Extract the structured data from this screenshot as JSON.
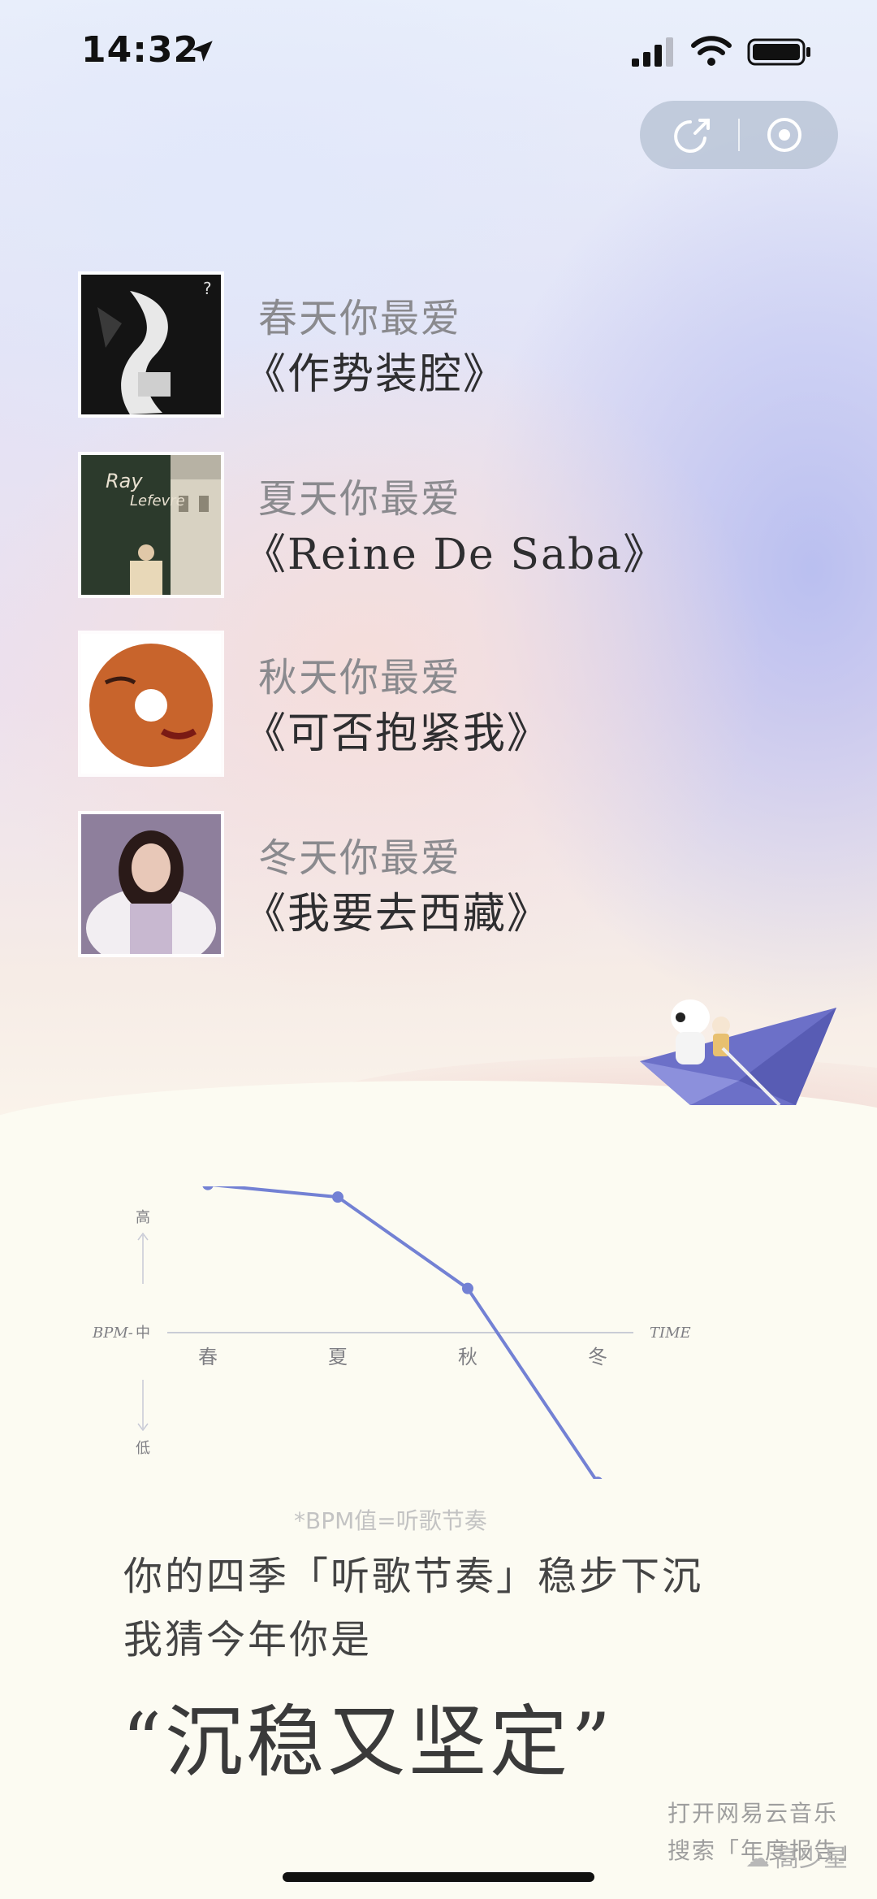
{
  "status_bar": {
    "time": "14:32"
  },
  "capsule": {
    "share_icon": "share-icon",
    "close_icon": "mini-program-close-icon"
  },
  "songs": [
    {
      "season": "春天你最爱",
      "title": "《作势装腔》"
    },
    {
      "season": "夏天你最爱",
      "title": "《Reine De Saba》"
    },
    {
      "season": "秋天你最爱",
      "title": "《可否抱紧我》"
    },
    {
      "season": "冬天你最爱",
      "title": "《我要去西藏》"
    }
  ],
  "chart_data": {
    "type": "line",
    "categories": [
      "春",
      "夏",
      "秋",
      "冬"
    ],
    "values": [
      0.94,
      0.86,
      0.28,
      -0.95
    ],
    "ylabel_axis": "BPM-",
    "y_levels": [
      "高",
      "中",
      "低"
    ],
    "xlabel": "TIME",
    "ylim": [
      -1,
      1
    ],
    "grid": false,
    "colors": {
      "line": "#7381d4",
      "axis": "#b9bccd"
    }
  },
  "footnote": "*BPM值=听歌节奏",
  "summary": {
    "line1": "你的四季「听歌节奏」稳步下沉",
    "line2": "我猜今年你是",
    "quote": "“沉稳又坚定”"
  },
  "cta": {
    "line1": "打开网易云音乐",
    "line2": "搜索「年度报告」"
  },
  "watermark": "高少星"
}
